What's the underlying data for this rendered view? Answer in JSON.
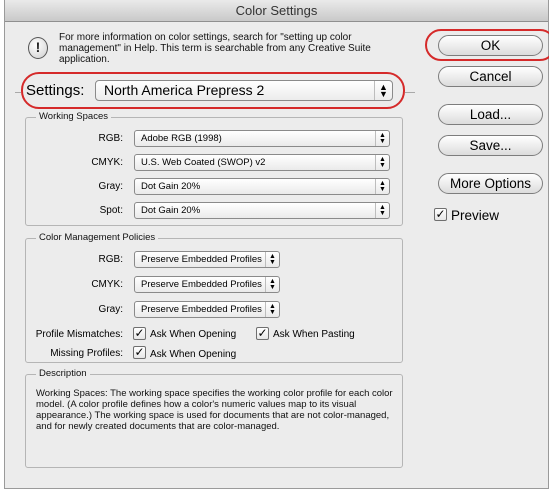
{
  "window": {
    "title": "Color Settings"
  },
  "info": {
    "icon": "info-exclamation-icon",
    "text": "For more information on color settings, search for \"setting up color management\" in Help. This term is searchable from any Creative Suite application."
  },
  "settings": {
    "label": "Settings:",
    "value": "North America Prepress 2"
  },
  "working_spaces": {
    "title": "Working Spaces",
    "rows": [
      {
        "label": "RGB:",
        "value": "Adobe RGB (1998)"
      },
      {
        "label": "CMYK:",
        "value": "U.S. Web Coated (SWOP) v2"
      },
      {
        "label": "Gray:",
        "value": "Dot Gain 20%"
      },
      {
        "label": "Spot:",
        "value": "Dot Gain 20%"
      }
    ]
  },
  "policies": {
    "title": "Color Management Policies",
    "rows": [
      {
        "label": "RGB:",
        "value": "Preserve Embedded Profiles"
      },
      {
        "label": "CMYK:",
        "value": "Preserve Embedded Profiles"
      },
      {
        "label": "Gray:",
        "value": "Preserve Embedded Profiles"
      }
    ],
    "profile_mismatches": {
      "label": "Profile Mismatches:",
      "ask_when_opening": {
        "label": "Ask When Opening",
        "checked": true
      },
      "ask_when_pasting": {
        "label": "Ask When Pasting",
        "checked": true
      }
    },
    "missing_profiles": {
      "label": "Missing Profiles:",
      "ask_when_opening": {
        "label": "Ask When Opening",
        "checked": true
      }
    }
  },
  "description": {
    "title": "Description",
    "text": "Working Spaces:  The working space specifies the working color profile for each color model.  (A color profile defines how a color's numeric values map to its visual appearance.)  The working space is used for documents that are not color-managed, and for newly created documents that are color-managed."
  },
  "buttons": {
    "ok": "OK",
    "cancel": "Cancel",
    "load": "Load...",
    "save": "Save...",
    "more_options": "More Options"
  },
  "preview": {
    "label": "Preview",
    "checked": true
  },
  "check_glyph": "✓",
  "colors": {
    "highlight_oval": "#d52a2a",
    "window_bg": "#ececec"
  }
}
